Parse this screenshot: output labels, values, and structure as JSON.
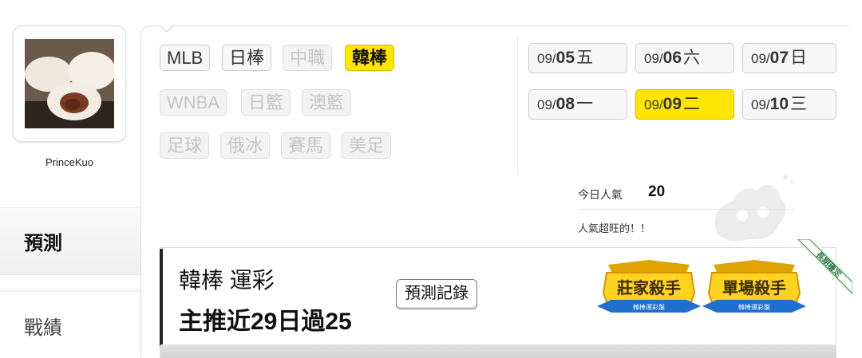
{
  "user": {
    "name": "PrinceKuo"
  },
  "nav": {
    "predict": "預測",
    "record": "戰績"
  },
  "leagues": [
    {
      "label": "MLB",
      "state": "on"
    },
    {
      "label": "日棒",
      "state": "on"
    },
    {
      "label": "中職",
      "state": "off"
    },
    {
      "label": "韓棒",
      "state": "selected"
    },
    {
      "label": "WNBA",
      "state": "off"
    },
    {
      "label": "日籃",
      "state": "off"
    },
    {
      "label": "澳籃",
      "state": "off"
    },
    {
      "label": "足球",
      "state": "off"
    },
    {
      "label": "俄冰",
      "state": "off"
    },
    {
      "label": "賽馬",
      "state": "off"
    },
    {
      "label": "美足",
      "state": "off"
    }
  ],
  "dates": [
    {
      "month": "09/",
      "day": "05",
      "weekday": "五"
    },
    {
      "month": "09/",
      "day": "06",
      "weekday": "六"
    },
    {
      "month": "09/",
      "day": "07",
      "weekday": "日"
    },
    {
      "month": "09/",
      "day": "08",
      "weekday": "一"
    },
    {
      "month": "09/",
      "day": "09",
      "weekday": "二",
      "selected": true
    },
    {
      "month": "09/",
      "day": "10",
      "weekday": "三"
    }
  ],
  "popularity": {
    "label": "今日人氣",
    "value": "20",
    "note": "人氣超旺的！！"
  },
  "card": {
    "title": "韓棒 運彩",
    "subtitle": "主推近29日過25",
    "history_button": "預測記錄",
    "badges": [
      {
        "title": "莊家殺手",
        "sub": "韓棒運彩盤"
      },
      {
        "title": "單場殺手",
        "sub": "韓棒運彩盤"
      }
    ],
    "ribbon": "長期穩定"
  },
  "colors": {
    "selected": "#ffe600",
    "badge_gold": "#f2b705",
    "badge_blue": "#1e6fd0"
  }
}
